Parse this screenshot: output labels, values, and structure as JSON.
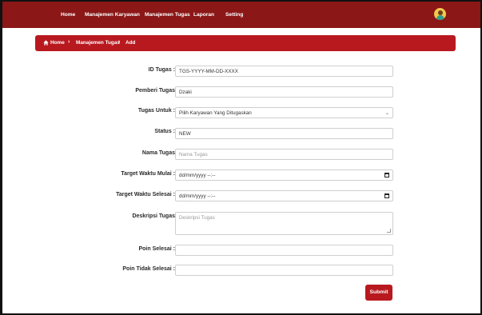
{
  "nav": {
    "items": [
      "Home",
      "Manajemen Karyawan",
      "Manajemen Tugas",
      "Laporan",
      "Setting"
    ]
  },
  "breadcrumb": {
    "home": "Home",
    "section": "Manajemen Tugas",
    "current": "Add",
    "separator": "›"
  },
  "form": {
    "id_tugas": {
      "label": "ID Tugas :",
      "value": "TGS-YYYY-MM-DD-XXXX"
    },
    "pemberi_tugas": {
      "label": "Pemberi Tugas",
      "value": "Dzaki"
    },
    "tugas_untuk": {
      "label": "Tugas Untuk :",
      "selected": "Pilih Karyawan Yang Ditugaskan"
    },
    "status": {
      "label": "Status :",
      "value": "NEW"
    },
    "nama_tugas": {
      "label": "Nama Tugas",
      "placeholder": "Nama Tugas"
    },
    "target_mulai": {
      "label": "Target Waktu Mulai :",
      "value": "dd/mm/yyyy --:--"
    },
    "target_selesai": {
      "label": "Target Waktu Selesai :",
      "value": "dd/mm/yyyy --:--"
    },
    "deskripsi": {
      "label": "Deskripsi Tugas",
      "placeholder": "Deskripsi Tugas"
    },
    "poin_selesai": {
      "label": "Poin Selesai :",
      "value": ""
    },
    "poin_tidak_selesai": {
      "label": "Poin Tidak Selesai :",
      "value": ""
    },
    "submit_label": "Submit"
  },
  "colors": {
    "navbar": "#8b1717",
    "accent": "#b8191f"
  },
  "icons": {
    "home": "home-icon",
    "avatar": "user-avatar",
    "select": "chevron-down-icon",
    "datetime": "calendar-icon"
  }
}
